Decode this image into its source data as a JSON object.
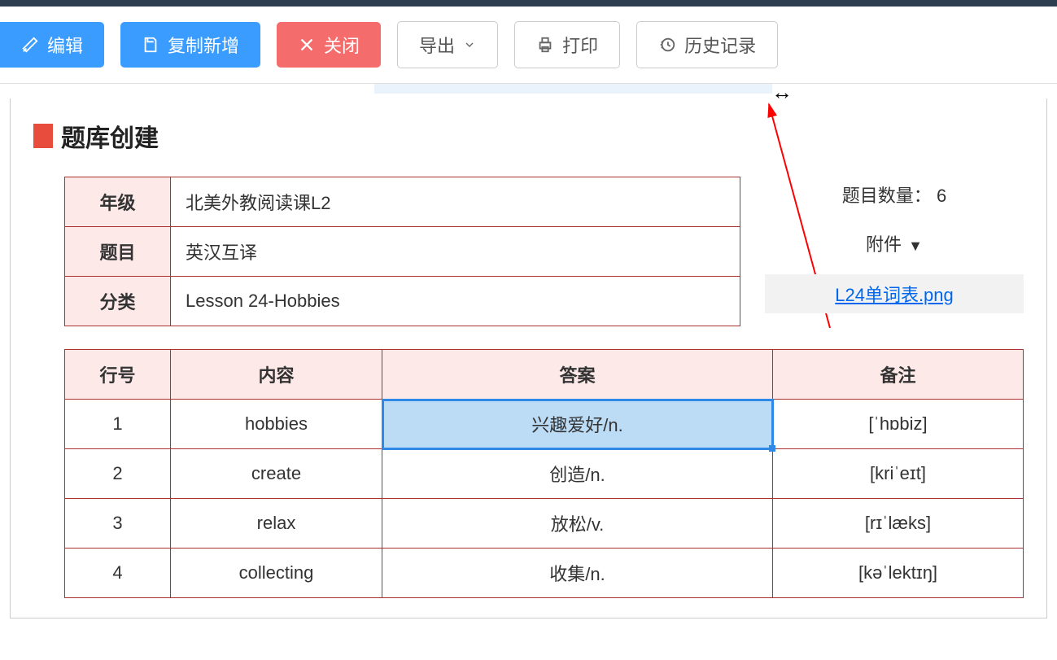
{
  "toolbar": {
    "edit": "编辑",
    "copy_new": "复制新增",
    "close": "关闭",
    "export": "导出",
    "print": "打印",
    "history": "历史记录"
  },
  "page": {
    "title": "题库创建"
  },
  "meta": {
    "grade_label": "年级",
    "grade_value": "北美外教阅读课L2",
    "topic_label": "题目",
    "topic_value": "英汉互译",
    "category_label": "分类",
    "category_value": "Lesson 24-Hobbies"
  },
  "side": {
    "count_label": "题目数量：",
    "count_value": "6",
    "attachment_label": "附件",
    "attachment_file": "L24单词表.png"
  },
  "table": {
    "headers": {
      "row_no": "行号",
      "content": "内容",
      "answer": "答案",
      "remark": "备注"
    },
    "rows": [
      {
        "no": "1",
        "content": "hobbies",
        "answer": "兴趣爱好/n.",
        "remark": "[ˈhɒbiz]",
        "selected": true
      },
      {
        "no": "2",
        "content": "create",
        "answer": "创造/n.",
        "remark": "[kriˈeɪt]",
        "selected": false
      },
      {
        "no": "3",
        "content": "relax",
        "answer": "放松/v.",
        "remark": "[rɪˈlæks]",
        "selected": false
      },
      {
        "no": "4",
        "content": "collecting",
        "answer": "收集/n.",
        "remark": "[kəˈlektɪŋ]",
        "selected": false
      }
    ]
  }
}
